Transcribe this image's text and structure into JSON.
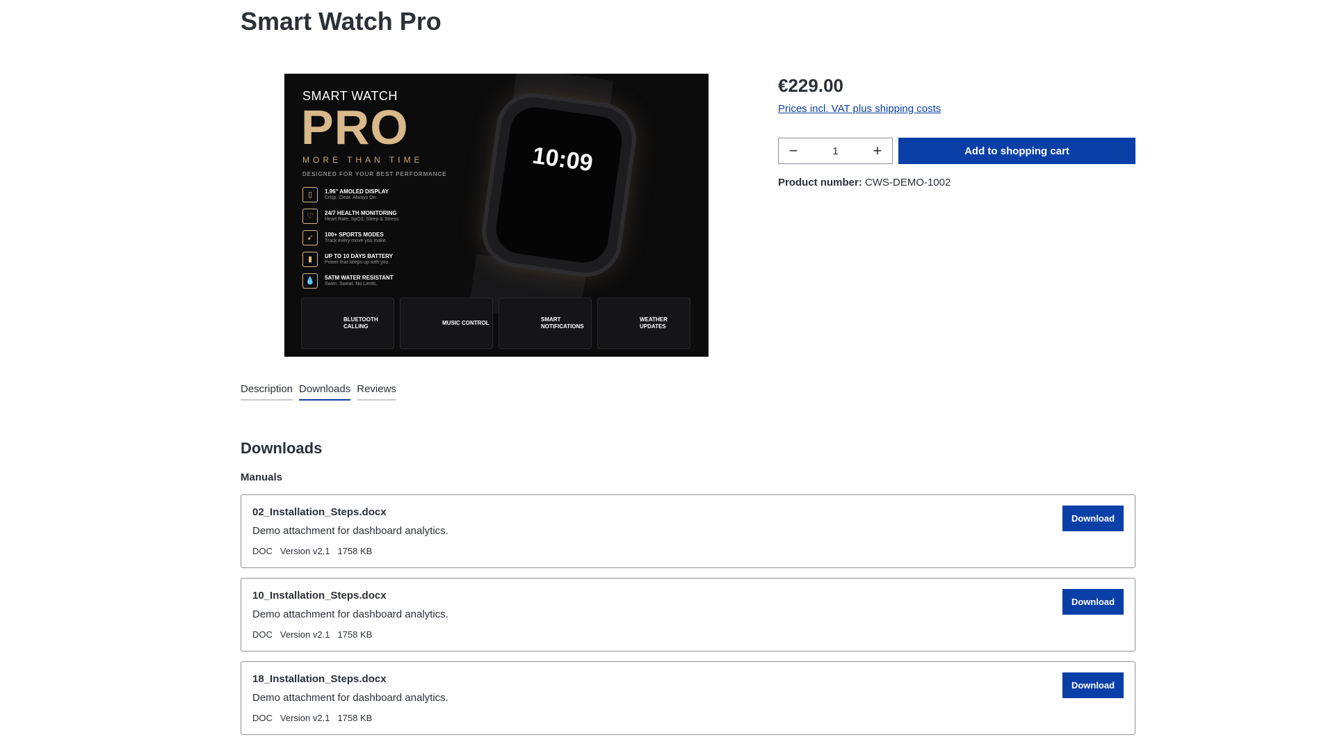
{
  "product": {
    "title": "Smart Watch Pro",
    "price": "€229.00",
    "vat_note": "Prices incl. VAT plus shipping costs",
    "quantity": "1",
    "add_to_cart_label": "Add to shopping cart",
    "product_number_label": "Product number:",
    "product_number": "CWS-DEMO-1002"
  },
  "image": {
    "brand_small": "SMART WATCH",
    "brand_big": "PRO",
    "tagline": "MORE THAN TIME",
    "designed": "DESIGNED FOR YOUR BEST PERFORMANCE",
    "watch_time": "10:09",
    "features": [
      {
        "title": "1.96\" AMOLED DISPLAY",
        "sub": "Crisp. Clear. Always On."
      },
      {
        "title": "24/7 HEALTH MONITORING",
        "sub": "Heart Rate, SpO2, Sleep & Stress."
      },
      {
        "title": "100+ SPORTS MODES",
        "sub": "Track every move you make."
      },
      {
        "title": "UP TO 10 DAYS BATTERY",
        "sub": "Power that keeps up with you."
      },
      {
        "title": "5ATM WATER RESISTANT",
        "sub": "Swim. Sweat. No Limits."
      }
    ],
    "footer_tiles": [
      "BLUETOOTH CALLING",
      "MUSIC CONTROL",
      "SMART NOTIFICATIONS",
      "WEATHER UPDATES"
    ]
  },
  "tabs": [
    {
      "label": "Description"
    },
    {
      "label": "Downloads"
    },
    {
      "label": "Reviews"
    }
  ],
  "downloads": {
    "title": "Downloads",
    "group": "Manuals",
    "button_label": "Download",
    "items": [
      {
        "name": "02_Installation_Steps.docx",
        "description": "Demo attachment for dashboard analytics.",
        "type": "DOC",
        "version": "Version v2.1",
        "size": "1758 KB"
      },
      {
        "name": "10_Installation_Steps.docx",
        "description": "Demo attachment for dashboard analytics.",
        "type": "DOC",
        "version": "Version v2.1",
        "size": "1758 KB"
      },
      {
        "name": "18_Installation_Steps.docx",
        "description": "Demo attachment for dashboard analytics.",
        "type": "DOC",
        "version": "Version v2.1",
        "size": "1758 KB"
      }
    ]
  },
  "icons": {
    "minus": "minus-icon",
    "plus": "plus-icon"
  }
}
